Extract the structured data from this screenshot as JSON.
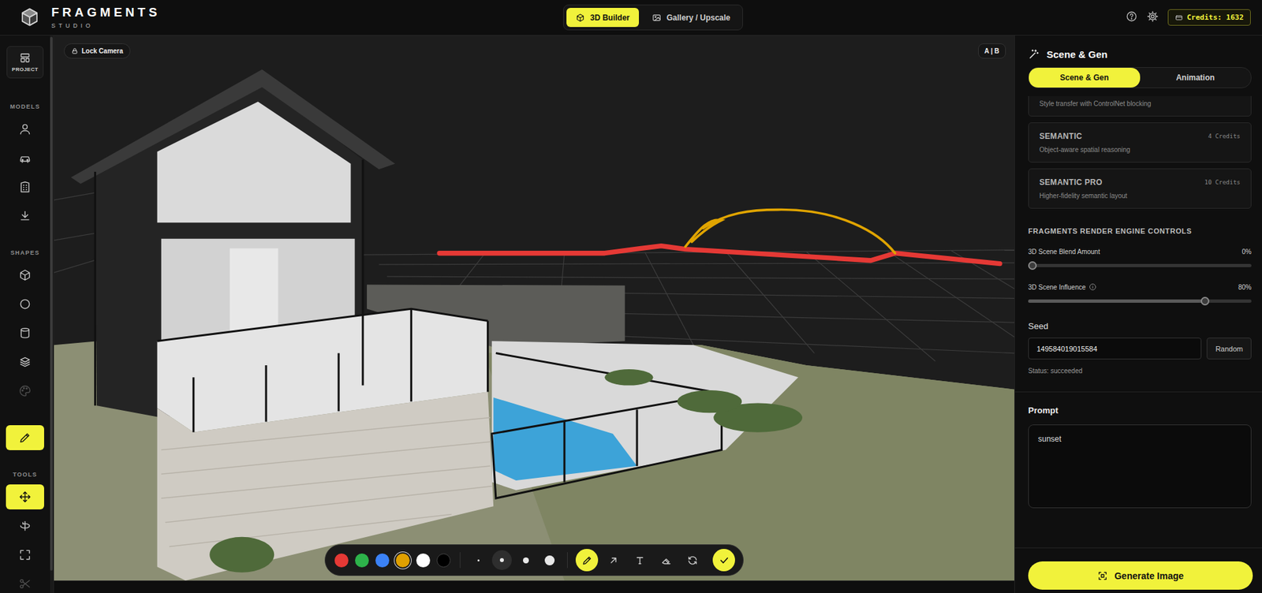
{
  "app": {
    "logo_title": "FRAGMENTS",
    "logo_subtitle": "STUDIO"
  },
  "top_tabs": [
    {
      "label": "3D Builder",
      "selected": true
    },
    {
      "label": "Gallery / Upscale",
      "selected": false
    }
  ],
  "credits": "Credits: 1632",
  "sidebar": {
    "project": {
      "label": "PROJECT"
    },
    "groups": [
      {
        "heading": "MODELS",
        "items": [
          {
            "selected": false,
            "disabled": false
          },
          {
            "selected": false,
            "disabled": false
          },
          {
            "selected": false,
            "disabled": false
          },
          {
            "selected": false,
            "disabled": false
          }
        ]
      },
      {
        "heading": "SHAPES",
        "items": [
          {
            "selected": false,
            "disabled": false
          },
          {
            "selected": false,
            "disabled": false
          },
          {
            "selected": false,
            "disabled": false
          },
          {
            "selected": false,
            "disabled": false
          },
          {
            "selected": false,
            "disabled": true
          }
        ]
      },
      {
        "items": [
          {
            "selected": true,
            "disabled": false
          }
        ]
      },
      {
        "heading": "TOOLS",
        "items": [
          {
            "selected": true,
            "disabled": false
          },
          {
            "selected": false,
            "disabled": false
          },
          {
            "selected": false,
            "disabled": false
          },
          {
            "selected": false,
            "disabled": true
          }
        ]
      }
    ]
  },
  "viewport": {
    "lock_camera": "Lock Camera",
    "ab_toggle": "A | B"
  },
  "draw_toolbar": {
    "colors": [
      {
        "color": "#e53935",
        "selected": false
      },
      {
        "color": "#2db34a",
        "selected": false
      },
      {
        "color": "#3b82f6",
        "selected": false
      },
      {
        "color": "#e0a000",
        "selected": true
      },
      {
        "color": "#ffffff",
        "selected": false
      },
      {
        "color": "#000000",
        "selected": false
      }
    ],
    "sizes": [
      {
        "selected": false
      },
      {
        "selected": true
      },
      {
        "selected": false
      },
      {
        "selected": false
      }
    ],
    "tools": [
      {
        "selected": true
      },
      {
        "selected": false
      },
      {
        "selected": false
      },
      {
        "selected": false
      },
      {
        "selected": false
      }
    ]
  },
  "panel": {
    "title": "Scene & Gen",
    "tabs": [
      {
        "label": "Scene & Gen",
        "selected": true
      },
      {
        "label": "Animation",
        "selected": false
      }
    ],
    "modes": [
      {
        "description": "Style transfer with ControlNet blocking",
        "selected": false
      },
      {
        "title": "SEMANTIC",
        "credits": "4 Credits",
        "description": "Object-aware spatial reasoning",
        "selected": false
      },
      {
        "title": "SEMANTIC PRO",
        "credits": "10 Credits",
        "description": "Higher-fidelity semantic layout",
        "selected": false
      }
    ],
    "section_heading": "FRAGMENTS RENDER ENGINE CONTROLS",
    "sliders": [
      {
        "label": "3D Scene Blend Amount",
        "reading": "0%",
        "level": 0,
        "info": false
      },
      {
        "label": "3D Scene Influence",
        "reading": "80%",
        "level": 0.8,
        "info": true
      }
    ],
    "seed": {
      "label": "Seed",
      "value": "149584019015584",
      "button": "Random"
    },
    "status": "Status: succeeded",
    "prompt": {
      "label": "Prompt",
      "value": "sunset"
    },
    "generate": "Generate Image"
  }
}
